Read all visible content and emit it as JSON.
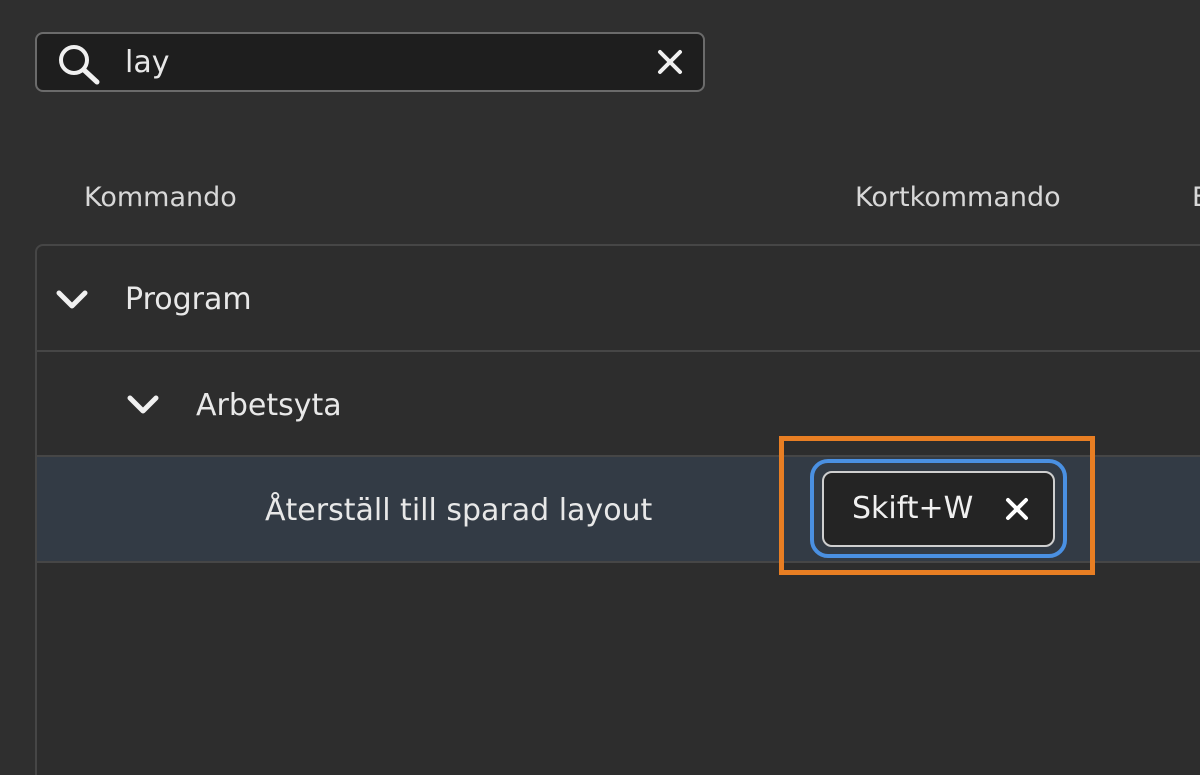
{
  "search": {
    "value": "lay",
    "icon": "search-icon",
    "clear_icon": "close-icon"
  },
  "columns": {
    "command": "Kommando",
    "shortcut": "Kortkommando",
    "extra": "E"
  },
  "tree": {
    "group": {
      "label": "Program",
      "icon": "chevron-down-icon"
    },
    "subgroup": {
      "label": "Arbetsyta",
      "icon": "chevron-down-icon"
    },
    "command": {
      "label": "Återställ till sparad layout",
      "shortcut": "Skift+W",
      "remove_icon": "close-icon"
    }
  },
  "colors": {
    "background": "#2f2f2f",
    "selected_row": "#333b45",
    "highlight": "#e87e23",
    "focus": "#4a90e2"
  }
}
